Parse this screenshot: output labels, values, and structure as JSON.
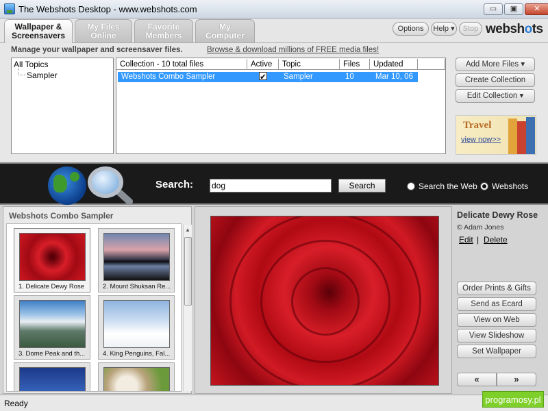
{
  "window": {
    "title": "The Webshots Desktop",
    "url": "www.webshots.com",
    "controls": {
      "minimize": "▭",
      "maximize": "▣",
      "close": "✕"
    }
  },
  "tabs": [
    {
      "line1": "Wallpaper &",
      "line2": "Screensavers",
      "active": true
    },
    {
      "line1": "My Files",
      "line2": "Online",
      "active": false
    },
    {
      "line1": "Favorite",
      "line2": "Members",
      "active": false
    },
    {
      "line1": "My",
      "line2": "Computer",
      "active": false
    }
  ],
  "toolbar": {
    "options": "Options",
    "help": "Help ▾",
    "stop": "Stop",
    "logo_a": "websh",
    "logo_dot": "o",
    "logo_b": "ts"
  },
  "manage": {
    "heading": "Manage your wallpaper and screensaver files.",
    "browse_link": "Browse & download millions of FREE media files!"
  },
  "tree": {
    "root": "All Topics",
    "child": "Sampler"
  },
  "table": {
    "headers": [
      "Collection - 10 total files",
      "Active",
      "Topic",
      "Files",
      "Updated"
    ],
    "rows": [
      {
        "collection": "Webshots Combo Sampler",
        "active": true,
        "active_mark": "✔",
        "topic": "Sampler",
        "files": "10",
        "updated": "Mar 10, 06"
      }
    ]
  },
  "collection_actions": {
    "add_more": "Add More Files  ▾",
    "create": "Create Collection",
    "edit": "Edit Collection  ▾"
  },
  "ad": {
    "title": "Travel",
    "link": "view now",
    "arrows": ">>"
  },
  "search": {
    "label": "Search:",
    "query": "dog",
    "button": "Search",
    "options": [
      {
        "label": "Search the Web",
        "selected": false
      },
      {
        "label": "Webshots",
        "selected": true
      }
    ]
  },
  "thumbs_panel": {
    "title": "Webshots Combo Sampler",
    "items": [
      {
        "caption": "1. Delicate Dewy Rose",
        "selected": true
      },
      {
        "caption": "2. Mount Shuksan Re...",
        "selected": false
      },
      {
        "caption": "3. Dome Peak and th...",
        "selected": false
      },
      {
        "caption": "4. King Penguins, Fal...",
        "selected": false
      },
      {
        "caption": "",
        "selected": false
      },
      {
        "caption": "",
        "selected": false
      }
    ]
  },
  "preview": {
    "title": "Delicate Dewy Rose",
    "author": "© Adam Jones",
    "edit": "Edit",
    "separator": "|",
    "delete": "Delete"
  },
  "actions": {
    "order_prints": "Order Prints & Gifts",
    "ecard": "Send as Ecard",
    "view_web": "View on Web",
    "slideshow": "View Slideshow",
    "set_wallpaper": "Set Wallpaper",
    "prev": "«",
    "next": "»"
  },
  "status": {
    "text": "Ready"
  },
  "watermark": "programosy.pl",
  "colors": {
    "selection": "#3399ff",
    "search_band": "#1a1a1a",
    "watermark": "#7fcf2a"
  }
}
